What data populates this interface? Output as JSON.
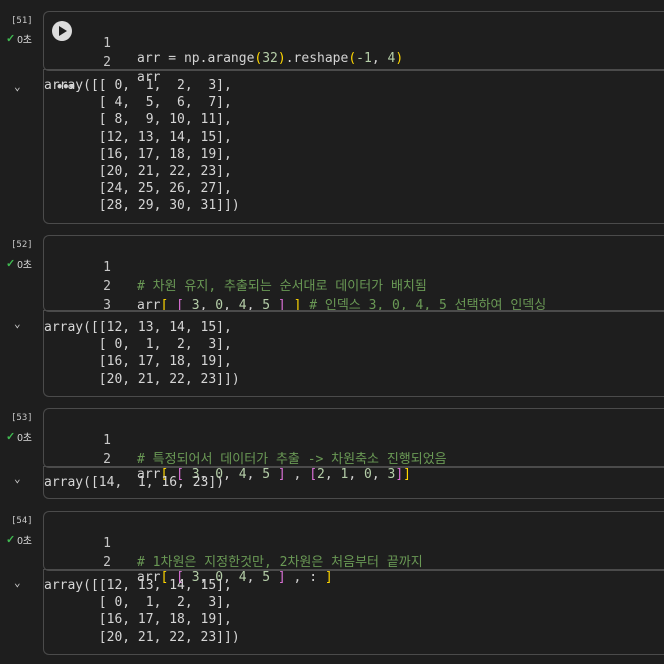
{
  "cells": [
    {
      "exec_count": "[51]",
      "status_time": "0초",
      "lines": [
        {
          "num": "1",
          "parts": [
            [
              "arr",
              ""
            ],
            [
              " = np.arange",
              ""
            ],
            [
              "(",
              "c-br2"
            ],
            [
              "32",
              "c-num"
            ],
            [
              ")",
              "c-br2"
            ],
            [
              ".reshape",
              ""
            ],
            [
              "(",
              "c-br2"
            ],
            [
              "-1",
              "c-num"
            ],
            [
              ", ",
              ""
            ],
            [
              "4",
              "c-num"
            ],
            [
              ")",
              "c-br2"
            ]
          ]
        },
        {
          "num": "2",
          "parts": [
            [
              "arr",
              ""
            ]
          ]
        }
      ],
      "output": "array([[ 0,  1,  2,  3],\n       [ 4,  5,  6,  7],\n       [ 8,  9, 10, 11],\n       [12, 13, 14, 15],\n       [16, 17, 18, 19],\n       [20, 21, 22, 23],\n       [24, 25, 26, 27],\n       [28, 29, 30, 31]])"
    },
    {
      "exec_count": "[52]",
      "status_time": "0초",
      "lines": [
        {
          "num": "1",
          "parts": [
            [
              "# 차원 유지, 추출되는 순서대로 데이터가 배치됨",
              "c-com"
            ]
          ]
        },
        {
          "num": "2",
          "parts": [
            [
              "arr",
              ""
            ],
            [
              "[",
              "c-br2"
            ],
            [
              " ",
              ""
            ],
            [
              "[",
              "c-br"
            ],
            [
              " ",
              ""
            ],
            [
              "3",
              "c-num"
            ],
            [
              ", ",
              ""
            ],
            [
              "0",
              "c-num"
            ],
            [
              ", ",
              ""
            ],
            [
              "4",
              "c-num"
            ],
            [
              ", ",
              ""
            ],
            [
              "5",
              "c-num"
            ],
            [
              " ",
              ""
            ],
            [
              "]",
              "c-br"
            ],
            [
              " ",
              ""
            ],
            [
              "]",
              "c-br2"
            ],
            [
              " ",
              ""
            ],
            [
              "# 인덱스 3, 0, 4, 5 선택하여 인덱싱",
              "c-com"
            ]
          ]
        },
        {
          "num": "3",
          "parts": []
        }
      ],
      "output": "array([[12, 13, 14, 15],\n       [ 0,  1,  2,  3],\n       [16, 17, 18, 19],\n       [20, 21, 22, 23]])"
    },
    {
      "exec_count": "[53]",
      "status_time": "0초",
      "lines": [
        {
          "num": "1",
          "parts": [
            [
              "# 특정되어서 데이터가 추출 -> 차원축소 진행되었음",
              "c-com"
            ]
          ]
        },
        {
          "num": "2",
          "parts": [
            [
              "arr",
              ""
            ],
            [
              "[",
              "c-br2"
            ],
            [
              " ",
              ""
            ],
            [
              "[",
              "c-br"
            ],
            [
              " ",
              ""
            ],
            [
              "3",
              "c-num"
            ],
            [
              ", ",
              ""
            ],
            [
              "0",
              "c-num"
            ],
            [
              ", ",
              ""
            ],
            [
              "4",
              "c-num"
            ],
            [
              ", ",
              ""
            ],
            [
              "5",
              "c-num"
            ],
            [
              " ",
              ""
            ],
            [
              "]",
              "c-br"
            ],
            [
              " , ",
              ""
            ],
            [
              "[",
              "c-br"
            ],
            [
              "2",
              "c-num"
            ],
            [
              ", ",
              ""
            ],
            [
              "1",
              "c-num"
            ],
            [
              ", ",
              ""
            ],
            [
              "0",
              "c-num"
            ],
            [
              ", ",
              ""
            ],
            [
              "3",
              "c-num"
            ],
            [
              "]",
              "c-br"
            ],
            [
              "]",
              "c-br2"
            ]
          ]
        }
      ],
      "output": "array([14,  1, 16, 23])"
    },
    {
      "exec_count": "[54]",
      "status_time": "0초",
      "lines": [
        {
          "num": "1",
          "parts": [
            [
              "# 1차원은 지정한것만, 2차원은 처음부터 끝까지",
              "c-com"
            ]
          ]
        },
        {
          "num": "2",
          "parts": [
            [
              "arr",
              ""
            ],
            [
              "[",
              "c-br2"
            ],
            [
              " ",
              ""
            ],
            [
              "[",
              "c-br"
            ],
            [
              " ",
              ""
            ],
            [
              "3",
              "c-num"
            ],
            [
              ", ",
              ""
            ],
            [
              "0",
              "c-num"
            ],
            [
              ", ",
              ""
            ],
            [
              "4",
              "c-num"
            ],
            [
              ", ",
              ""
            ],
            [
              "5",
              "c-num"
            ],
            [
              " ",
              ""
            ],
            [
              "]",
              "c-br"
            ],
            [
              " , : ",
              ""
            ],
            [
              "]",
              "c-br2"
            ]
          ]
        }
      ],
      "output": "array([[12, 13, 14, 15],\n       [ 0,  1,  2,  3],\n       [16, 17, 18, 19],\n       [20, 21, 22, 23]])"
    }
  ]
}
